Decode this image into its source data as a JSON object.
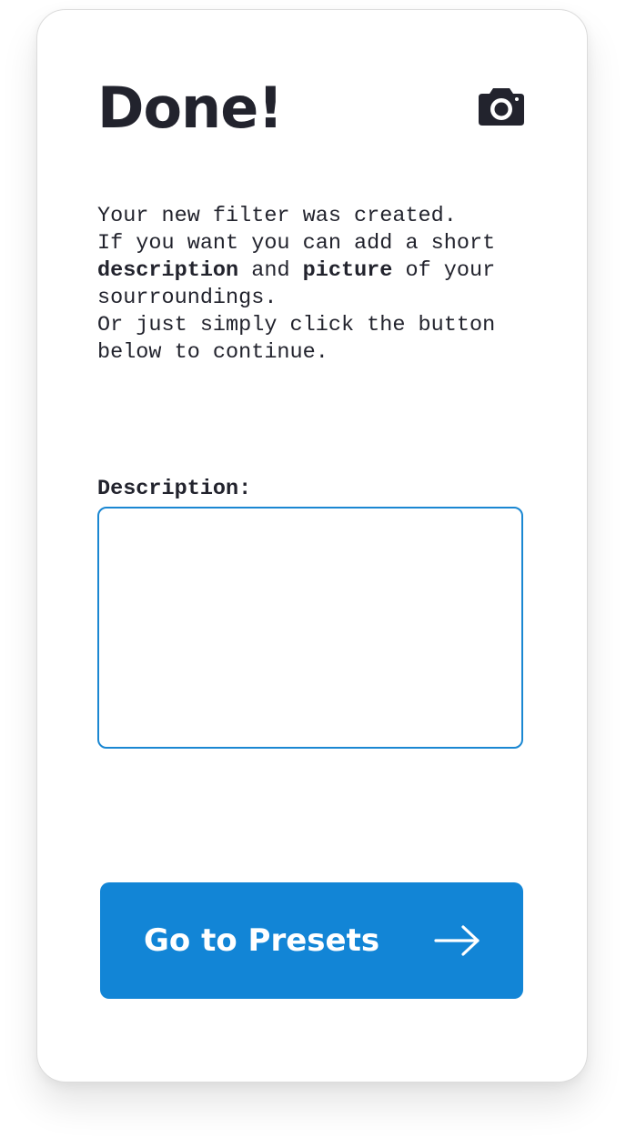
{
  "screen": {
    "title": "Done!",
    "camera_icon": "camera-icon"
  },
  "intro": {
    "line1": "Your new filter was created.",
    "line2": "If you want you can add a short",
    "line3_bold1": "description",
    "line3_mid": " and ",
    "line3_bold2": "picture",
    "line3_end": " of your",
    "line4": "sourroundings.",
    "line5": "Or just simply click the button",
    "line6": "below to continue."
  },
  "description": {
    "label": "Description:",
    "value": "",
    "placeholder": ""
  },
  "cta": {
    "label": "Go to Presets",
    "icon": "arrow-right-icon"
  },
  "colors": {
    "accent": "#1285d6",
    "input_border": "#1a87d2",
    "text": "#22232d"
  }
}
